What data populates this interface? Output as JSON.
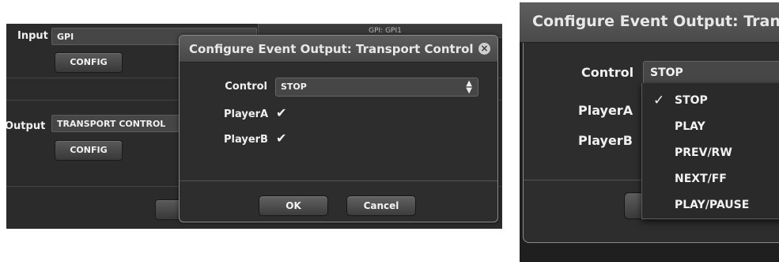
{
  "background_panel": {
    "input_label": "Input",
    "input_value": "GPI",
    "input_config_label": "CONFIG",
    "gpi_box_text": "GPI: GPI1",
    "output_label": "Output",
    "output_value": "TRANSPORT CONTROL",
    "output_config_label": "CONFIG"
  },
  "dialog": {
    "title": "Configure Event Output: Transport Control",
    "close_icon": "close-icon",
    "control_label": "Control",
    "control_value": "STOP",
    "player_a_label": "PlayerA",
    "player_b_label": "PlayerB",
    "player_a_checked": true,
    "player_b_checked": true,
    "ok_label": "OK",
    "cancel_label": "Cancel"
  },
  "zoom_panel": {
    "title": "Configure Event Output: Trans",
    "control_label": "Control",
    "control_value": "STOP",
    "player_a_label": "PlayerA",
    "player_b_label": "PlayerB",
    "dropdown_options": [
      {
        "label": "STOP",
        "selected": true
      },
      {
        "label": "PLAY",
        "selected": false
      },
      {
        "label": "PREV/RW",
        "selected": false
      },
      {
        "label": "NEXT/FF",
        "selected": false
      },
      {
        "label": "PLAY/PAUSE",
        "selected": false
      }
    ]
  }
}
